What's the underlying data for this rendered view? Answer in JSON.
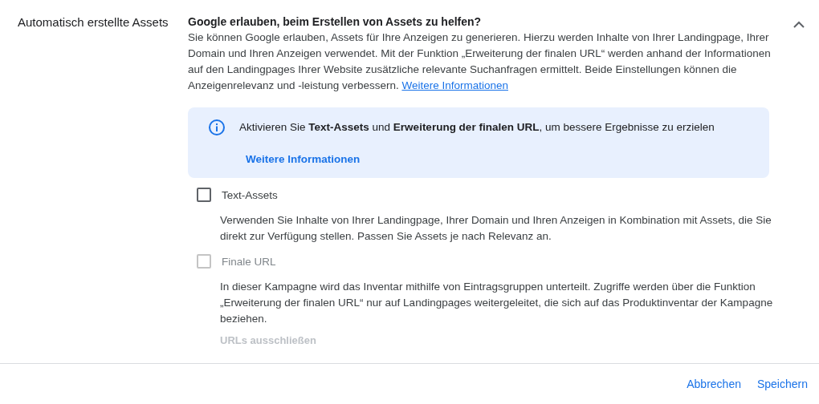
{
  "section": {
    "title": "Automatisch erstellte Assets",
    "expanded": true
  },
  "question": "Google erlauben, beim Erstellen von Assets zu helfen?",
  "description": "Sie können Google erlauben, Assets für Ihre Anzeigen zu generieren. Hierzu werden Inhalte von Ihrer Landingpage, Ihrer Domain und Ihren Anzeigen verwendet. Mit der Funktion „Erweiterung der finalen URL“ werden anhand der Informationen auf den Landingpages Ihrer Website zusätzliche relevante Suchanfragen ermittelt. Beide Einstellungen können die Anzeigenrelevanz und -leistung verbessern.",
  "description_link": "Weitere Informationen",
  "info": {
    "message": "Aktivieren Sie **Text-Assets** und **Erweiterung der finalen URL**, um bessere Ergebnisse zu erzielen",
    "link": "Weitere Informationen"
  },
  "options": [
    {
      "label": "Text-Assets",
      "checked": false,
      "disabled": false,
      "description": "Verwenden Sie Inhalte von Ihrer Landingpage, Ihrer Domain und Ihren Anzeigen in Kombination mit Assets, die Sie direkt zur Verfügung stellen. Passen Sie Assets je nach Relevanz an."
    },
    {
      "label": "Finale URL",
      "checked": false,
      "disabled": true,
      "description": "In dieser Kampagne wird das Inventar mithilfe von Eintragsgruppen unterteilt. Zugriffe werden über die Funktion „Erweiterung der finalen URL“ nur auf Landingpages weitergeleitet, die sich auf das Produktinventar der Kampagne beziehen.",
      "link": {
        "label": "URLs ausschließen",
        "disabled": true
      }
    }
  ],
  "buttons": [
    {
      "label": "Abbrechen"
    },
    {
      "label": "Speichern"
    }
  ]
}
